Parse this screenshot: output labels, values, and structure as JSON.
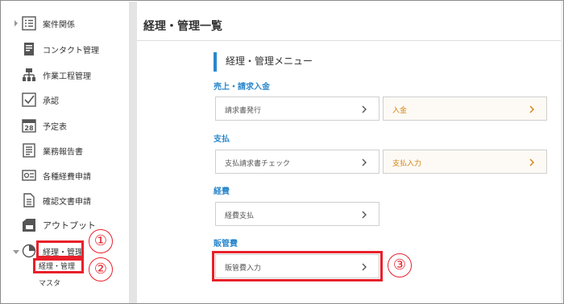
{
  "sidebar": {
    "items": [
      {
        "label": "案件関係",
        "icon": "list-icon"
      },
      {
        "label": "コンタクト管理",
        "icon": "document-icon"
      },
      {
        "label": "作業工程管理",
        "icon": "org-chart-icon"
      },
      {
        "label": "承認",
        "icon": "checkbox-icon"
      },
      {
        "label": "予定表",
        "icon": "calendar-icon",
        "icon_text": "28"
      },
      {
        "label": "業務報告書",
        "icon": "report-icon"
      },
      {
        "label": "各種経費申請",
        "icon": "expense-icon"
      },
      {
        "label": "確認文書申請",
        "icon": "document-lines-icon"
      },
      {
        "label": "アウトプット",
        "icon": "output-icon"
      },
      {
        "label": "経理・管理",
        "icon": "pie-chart-icon"
      }
    ],
    "sub_items": [
      {
        "label": "経理・管理"
      },
      {
        "label": "マスタ"
      }
    ]
  },
  "main": {
    "title": "経理・管理一覧",
    "menu_heading": "経理・管理メニュー",
    "sections": [
      {
        "label": "売上・請求入金",
        "buttons": [
          {
            "label": "請求書発行",
            "style": "plain"
          },
          {
            "label": "入金",
            "style": "orange"
          }
        ]
      },
      {
        "label": "支払",
        "buttons": [
          {
            "label": "支払請求書チェック",
            "style": "plain"
          },
          {
            "label": "支払入力",
            "style": "orange"
          }
        ]
      },
      {
        "label": "経費",
        "buttons": [
          {
            "label": "経費支払",
            "style": "plain"
          }
        ]
      },
      {
        "label": "販管費",
        "buttons": [
          {
            "label": "販管費入力",
            "style": "plain"
          }
        ]
      }
    ]
  },
  "annotations": {
    "markers": [
      "①",
      "②",
      "③"
    ],
    "highlight_color": "#e8202a"
  },
  "colors": {
    "accent": "#2a87cc",
    "orange": "#d4820f"
  }
}
